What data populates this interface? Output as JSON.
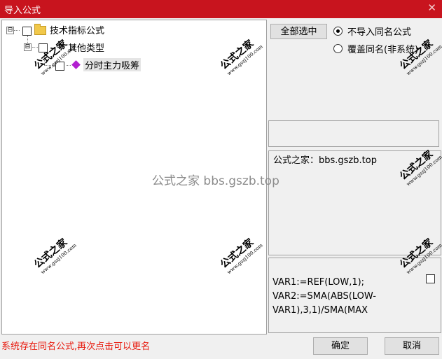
{
  "window": {
    "title": "导入公式",
    "close_glyph": "✕"
  },
  "tree": {
    "root": {
      "label": "技术指标公式",
      "expander": "⊟"
    },
    "child": {
      "label": "其他类型",
      "expander": "⊟"
    },
    "leaf": {
      "label": "分时主力吸筹"
    }
  },
  "options": {
    "select_all_label": "全部选中",
    "radio_skip_label": "不导入同名公式",
    "radio_overwrite_label": "覆盖同名(非系统)",
    "radio_skip_selected": true
  },
  "name_field": {
    "value": ""
  },
  "description": {
    "text": "公式之家：bbs.gszb.top"
  },
  "code_preview": {
    "lines": [
      "VAR1:=REF(LOW,1);",
      "VAR2:=SMA(ABS(LOW-",
      "VAR1),3,1)/SMA(MAX"
    ]
  },
  "status_message": "系统存在同名公式,再次点击可以更名",
  "buttons": {
    "ok_label": "确定",
    "cancel_label": "取消"
  },
  "watermarks": {
    "main_text": "公式之家",
    "url_text": "www.gszj100.com",
    "center_text": "公式之家 bbs.gszb.top"
  },
  "colors": {
    "titlebar": "#c8141e",
    "status_text": "#e8180c",
    "watermark_center": "#8c8c8c"
  }
}
